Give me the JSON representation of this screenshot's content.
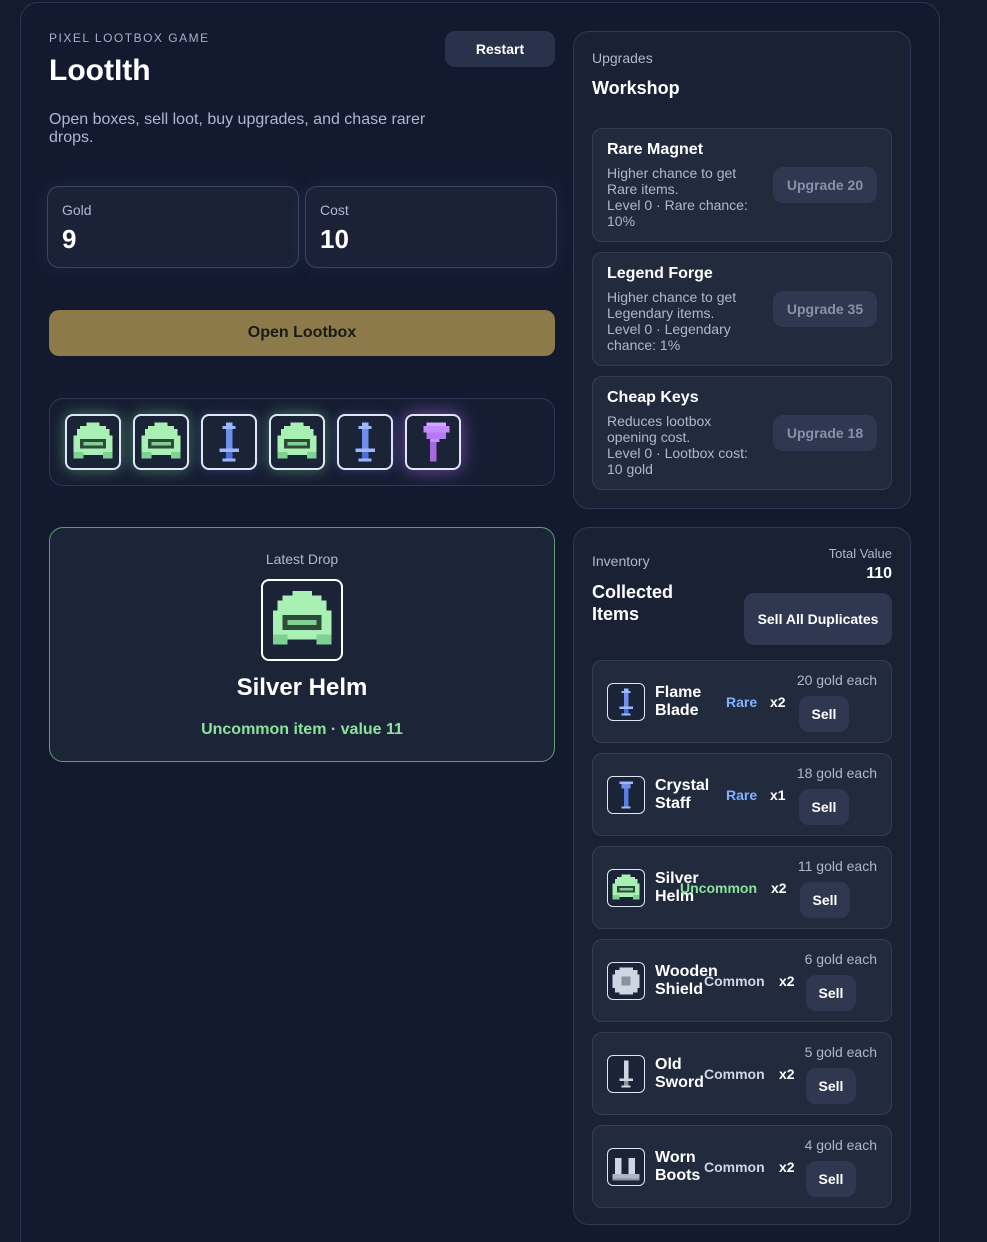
{
  "header": {
    "eyebrow": "PIXEL LOOTBOX GAME",
    "title": "LootIth",
    "subtitle": "Open boxes, sell loot, buy upgrades, and chase rarer drops.",
    "restart_label": "Restart"
  },
  "stats": {
    "gold_label": "Gold",
    "gold_value": "9",
    "cost_label": "Cost",
    "cost_value": "10"
  },
  "open_button_label": "Open Lootbox",
  "recent_drops": [
    {
      "icon": "helm-icon",
      "rarity": "Uncommon"
    },
    {
      "icon": "helm-icon",
      "rarity": "Uncommon"
    },
    {
      "icon": "blade-icon",
      "rarity": "Rare"
    },
    {
      "icon": "helm-icon",
      "rarity": "Uncommon"
    },
    {
      "icon": "blade-icon",
      "rarity": "Rare"
    },
    {
      "icon": "axe-icon",
      "rarity": "Epic"
    }
  ],
  "latest_drop": {
    "label": "Latest Drop",
    "name": "Silver Helm",
    "info": "Uncommon item · value 11"
  },
  "upgrades": {
    "eyebrow": "Upgrades",
    "title": "Workshop",
    "items": [
      {
        "name": "Rare Magnet",
        "desc": "Higher chance to get Rare items.",
        "level": "Level 0 · Rare chance: 10%",
        "button": "Upgrade 20"
      },
      {
        "name": "Legend Forge",
        "desc": "Higher chance to get Legendary items.",
        "level": "Level 0 · Legendary chance: 1%",
        "button": "Upgrade 35"
      },
      {
        "name": "Cheap Keys",
        "desc": "Reduces lootbox opening cost.",
        "level": "Level 0 · Lootbox cost: 10 gold",
        "button": "Upgrade 18"
      }
    ]
  },
  "inventory": {
    "eyebrow": "Inventory",
    "title": "Collected Items",
    "total_label": "Total Value",
    "total_value": "110",
    "sell_all_label": "Sell All Duplicates",
    "items": [
      {
        "name": "Flame Blade",
        "rarity": "Rare",
        "qty": "x2",
        "each": "20 gold each",
        "sell": "Sell",
        "icon": "blade-icon"
      },
      {
        "name": "Crystal Staff",
        "rarity": "Rare",
        "qty": "x1",
        "each": "18 gold each",
        "sell": "Sell",
        "icon": "staff-icon"
      },
      {
        "name": "Silver Helm",
        "rarity": "Uncommon",
        "qty": "x2",
        "each": "11 gold each",
        "sell": "Sell",
        "icon": "helm-icon"
      },
      {
        "name": "Wooden Shield",
        "rarity": "Common",
        "qty": "x2",
        "each": "6 gold each",
        "sell": "Sell",
        "icon": "shield-icon"
      },
      {
        "name": "Old Sword",
        "rarity": "Common",
        "qty": "x2",
        "each": "5 gold each",
        "sell": "Sell",
        "icon": "sword-icon"
      },
      {
        "name": "Worn Boots",
        "rarity": "Common",
        "qty": "x2",
        "each": "4 gold each",
        "sell": "Sell",
        "icon": "boots-icon"
      }
    ]
  },
  "colors": {
    "uncommon": "#8be39c",
    "rare": "#7fb2ff",
    "common": "#cfd5e3",
    "gold_button": "#8c7a4a",
    "epic": "#c58cff"
  }
}
